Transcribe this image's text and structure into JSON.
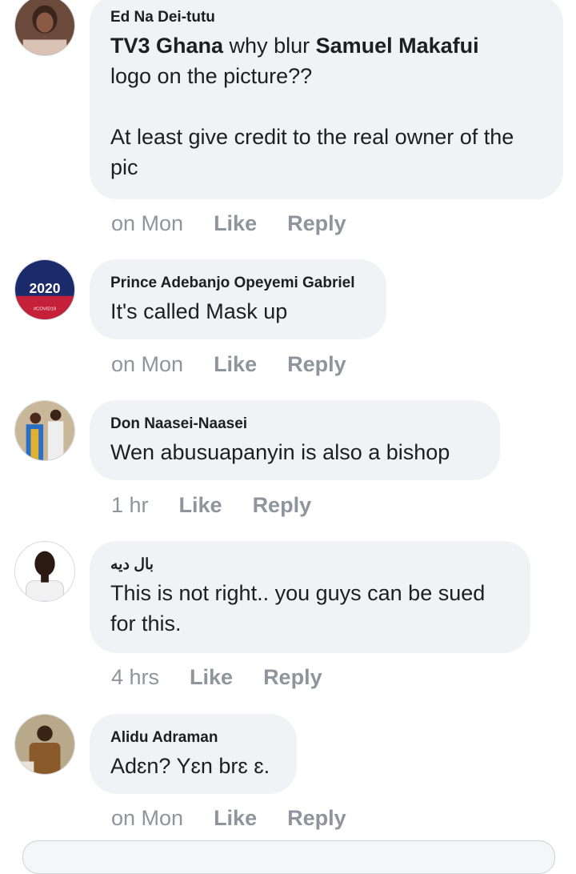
{
  "comments": [
    {
      "author": "Ed Na Dei-tutu",
      "segments": [
        {
          "text": "TV3 Ghana",
          "bold": true
        },
        {
          "text": " why blur ",
          "bold": false
        },
        {
          "text": "Samuel Makafui",
          "bold": true
        },
        {
          "text": "\nlogo on the picture??\n\nAt least give credit to the real owner of the\npic",
          "bold": false
        }
      ],
      "time": "on Mon",
      "like": "Like",
      "reply": "Reply"
    },
    {
      "author": "Prince Adebanjo Opeyemi Gabriel",
      "segments": [
        {
          "text": "It's called Mask up",
          "bold": false
        }
      ],
      "time": "on Mon",
      "like": "Like",
      "reply": "Reply",
      "avatar_text": {
        "line1": "2020",
        "line2": "#COVID19"
      }
    },
    {
      "author": "Don Naasei-Naasei",
      "segments": [
        {
          "text": "Wen abusuapanyin is also a bishop",
          "bold": false
        }
      ],
      "time": "1 hr",
      "like": "Like",
      "reply": "Reply"
    },
    {
      "author": "بال ديه",
      "segments": [
        {
          "text": "This is not right.. you guys can be sued\nfor this.",
          "bold": false
        }
      ],
      "time": "4 hrs",
      "like": "Like",
      "reply": "Reply"
    },
    {
      "author": "Alidu Adraman",
      "segments": [
        {
          "text": "Adɛn? Yɛn brɛ ɛ.",
          "bold": false
        }
      ],
      "time": "on Mon",
      "like": "Like",
      "reply": "Reply"
    }
  ],
  "colors": {
    "bubble": "#f0f2f5",
    "meta_text": "#90949c",
    "body_text": "#1c1e21"
  }
}
